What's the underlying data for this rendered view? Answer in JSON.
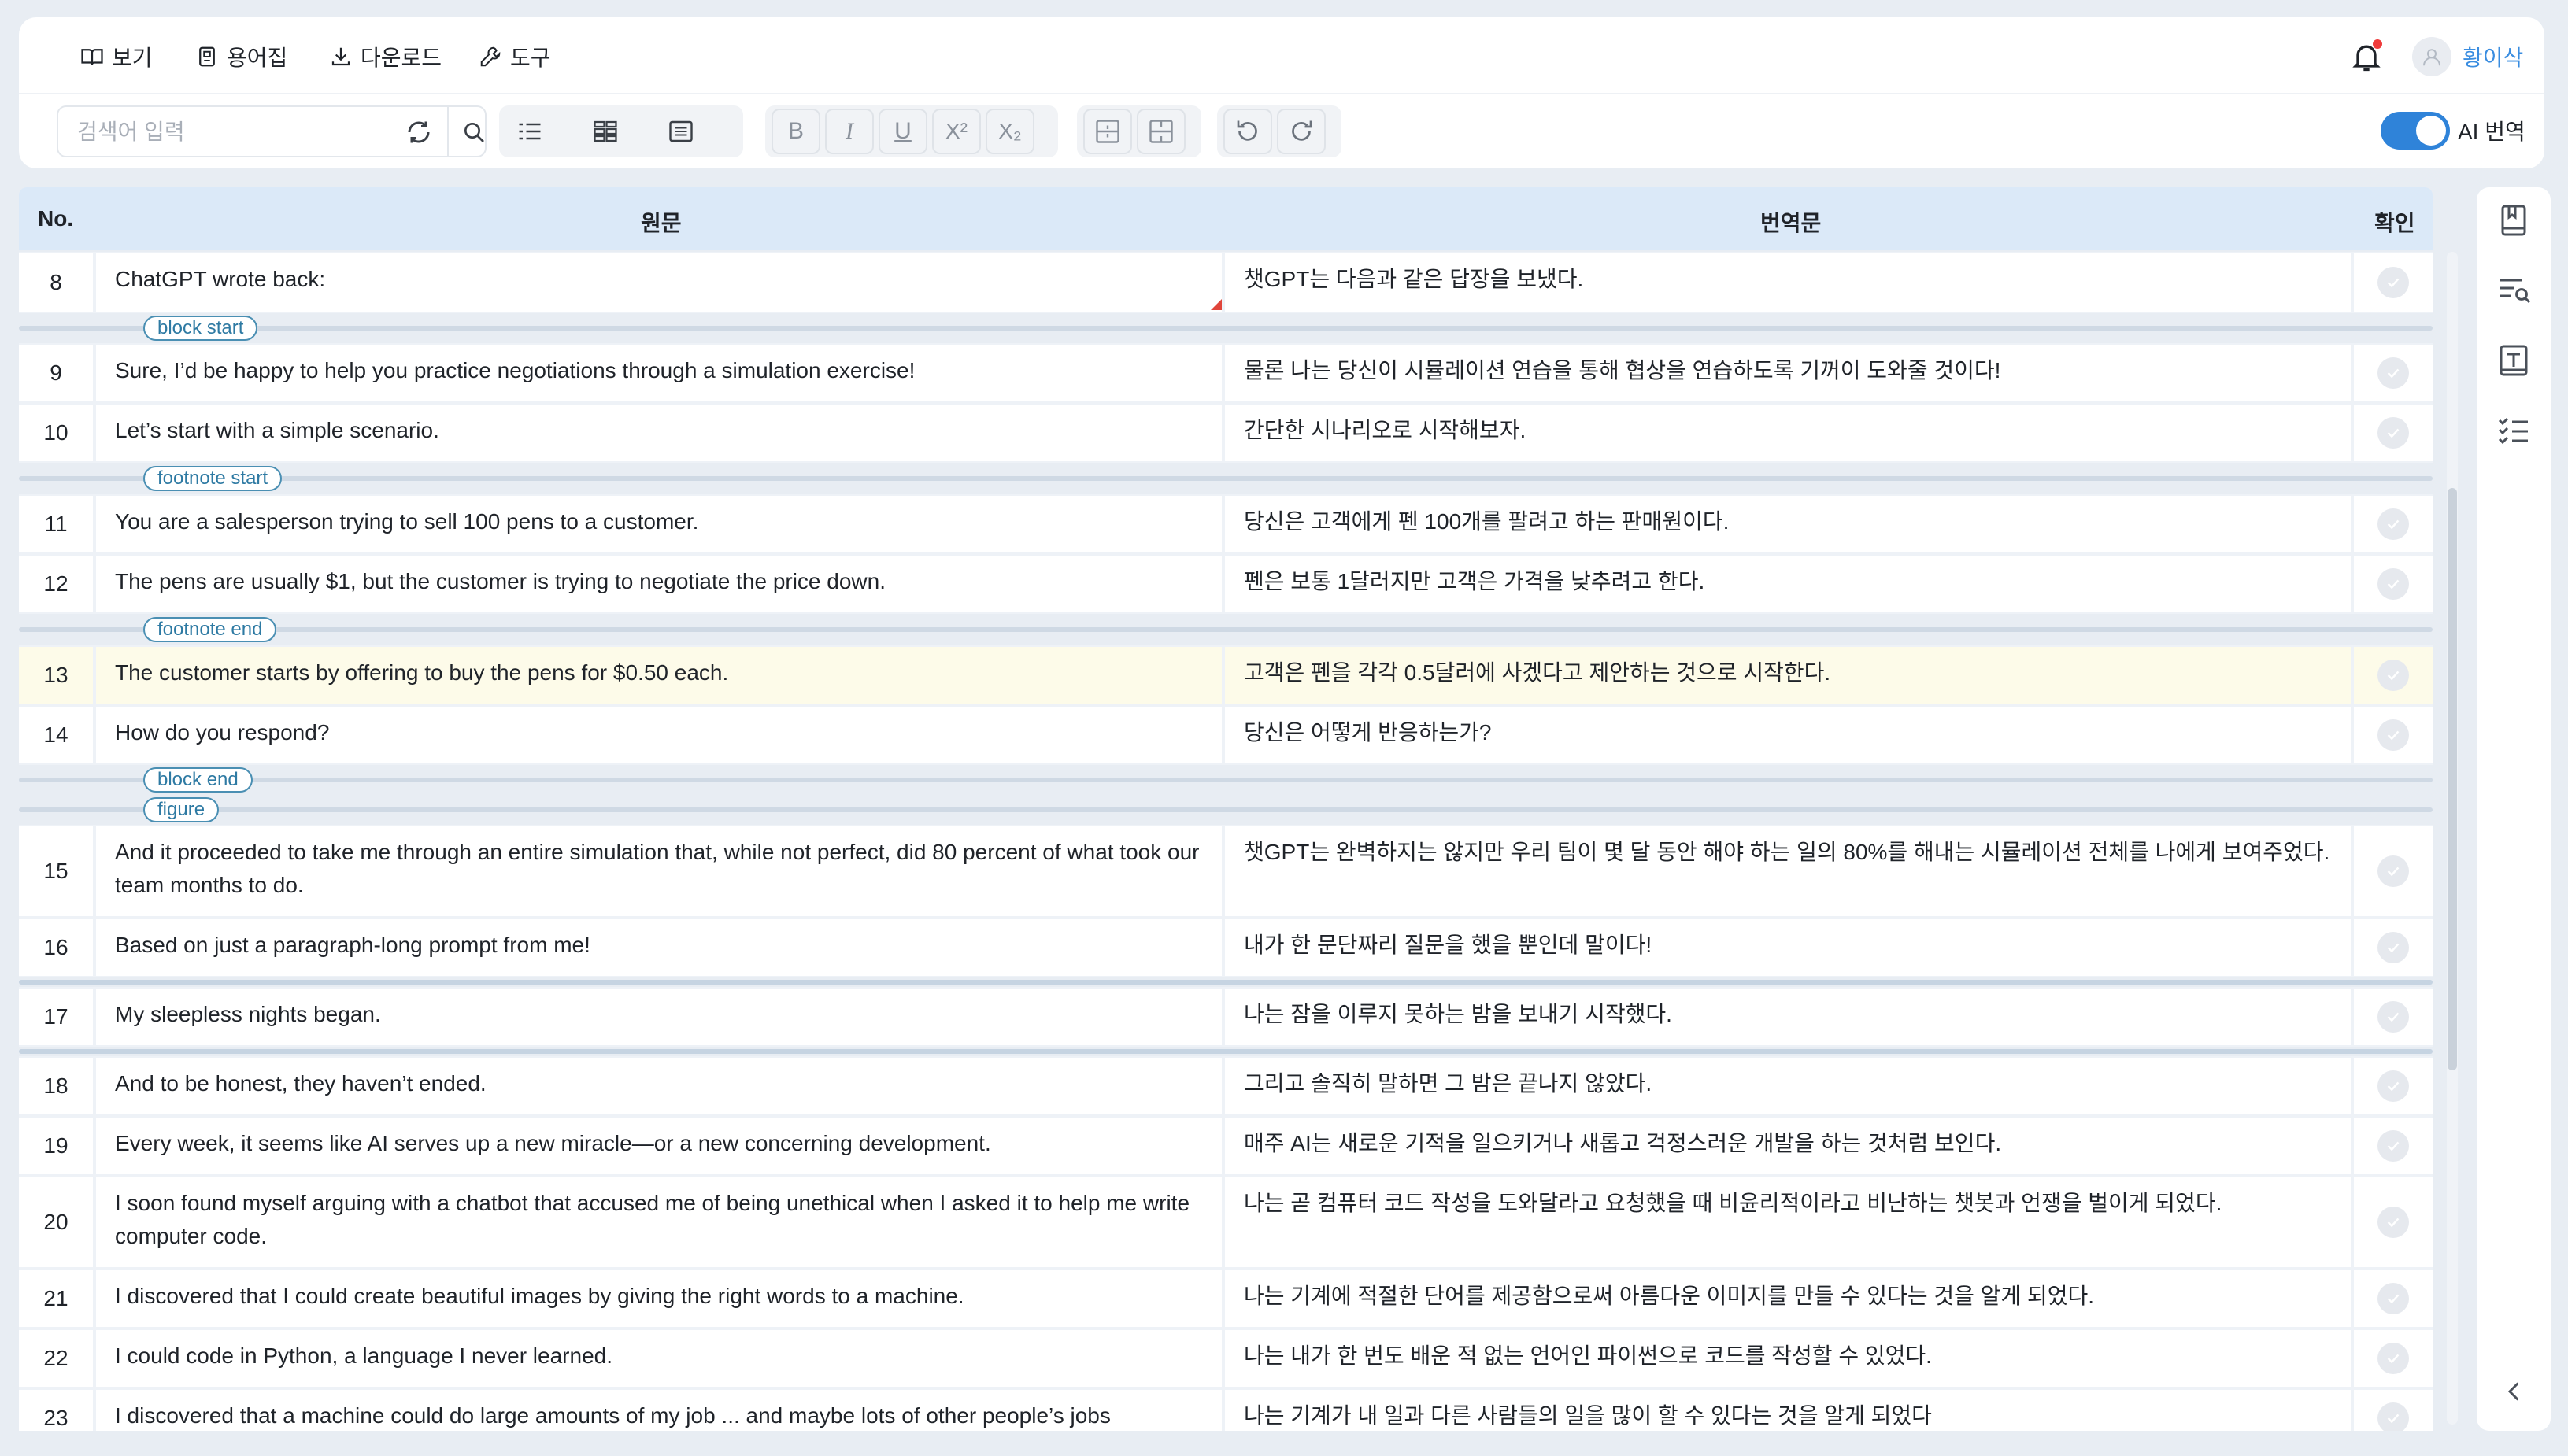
{
  "menu": {
    "view": "보기",
    "glossary": "용어집",
    "download": "다운로드",
    "tools": "도구"
  },
  "user": {
    "name": "황이삭"
  },
  "search": {
    "placeholder": "검색어 입력"
  },
  "format": {
    "bold": "B",
    "italic": "I",
    "underline": "U",
    "superscript": "X²",
    "subscript": "X₂"
  },
  "ai_toggle": {
    "label": "AI 번역",
    "on": true
  },
  "table": {
    "headers": {
      "no": "No.",
      "source": "원문",
      "target": "번역문",
      "confirm": "확인"
    },
    "rows": [
      {
        "no": "8",
        "src": "ChatGPT wrote back:",
        "tgt": "챗GPT는 다음과 같은 답장을 보냈다."
      },
      {
        "no": "9",
        "src": "Sure, I’d be happy to help you practice negotiations through a simulation exercise!",
        "tgt": "물론 나는 당신이 시뮬레이션 연습을 통해 협상을 연습하도록 기꺼이 도와줄 것이다!"
      },
      {
        "no": "10",
        "src": "Let’s start with a simple scenario.",
        "tgt": "간단한 시나리오로 시작해보자."
      },
      {
        "no": "11",
        "src": "You are a salesperson trying to sell 100 pens to a customer.",
        "tgt": "당신은 고객에게 펜 100개를 팔려고 하는 판매원이다."
      },
      {
        "no": "12",
        "src": "The pens are usually $1, but the customer is trying to negotiate the price down.",
        "tgt": "펜은 보통 1달러지만 고객은 가격을 낮추려고 한다."
      },
      {
        "no": "13",
        "src": "The customer starts by offering to buy the pens for $0.50 each.",
        "tgt": "고객은 펜을 각각 0.5달러에 사겠다고 제안하는 것으로 시작한다."
      },
      {
        "no": "14",
        "src": "How do you respond?",
        "tgt": "당신은 어떻게 반응하는가?"
      },
      {
        "no": "15",
        "src": "And it proceeded to take me through an entire simulation that, while not perfect, did 80 percent of what took our team months to do.",
        "tgt": "챗GPT는 완벽하지는 않지만 우리 팀이 몇 달 동안 해야 하는 일의 80%를 해내는 시뮬레이션 전체를 나에게 보여주었다."
      },
      {
        "no": "16",
        "src": "Based on just a paragraph-long prompt from me!",
        "tgt": "내가 한 문단짜리 질문을 했을 뿐인데 말이다!"
      },
      {
        "no": "17",
        "src": "My sleepless nights began.",
        "tgt": "나는 잠을 이루지 못하는 밤을 보내기 시작했다."
      },
      {
        "no": "18",
        "src": "And to be honest, they haven’t ended.",
        "tgt": "그리고 솔직히 말하면 그 밤은 끝나지 않았다."
      },
      {
        "no": "19",
        "src": "Every week, it seems like AI serves up a new miracle—or a new concerning development.",
        "tgt": "매주 AI는 새로운 기적을 일으키거나 새롭고 걱정스러운 개발을 하는 것처럼 보인다."
      },
      {
        "no": "20",
        "src": "I soon found myself arguing with a chatbot that accused me of being unethical when I asked it to help me write computer code.",
        "tgt": "나는 곧 컴퓨터 코드 작성을 도와달라고 요청했을 때 비윤리적이라고 비난하는 챗봇과 언쟁을 벌이게 되었다."
      },
      {
        "no": "21",
        "src": "I discovered that I could create beautiful images by giving the right words to a machine.",
        "tgt": "나는 기계에 적절한 단어를 제공함으로써 아름다운 이미지를 만들 수 있다는 것을 알게 되었다."
      },
      {
        "no": "22",
        "src": "I could code in Python, a language I never learned.",
        "tgt": "나는 내가 한 번도 배운 적 없는 언어인 파이썬으로 코드를 작성할 수 있었다."
      },
      {
        "no": "23",
        "src": "I discovered that a machine could do large amounts of my job ... and maybe lots of other people’s jobs",
        "tgt": "나는 기계가 내 일과 다른 사람들의 일을 많이 할 수 있다는 것을 알게 되었다"
      }
    ],
    "tags": {
      "block_start": "block start",
      "footnote_start": "footnote start",
      "footnote_end": "footnote end",
      "block_end": "block end",
      "figure": "figure"
    }
  },
  "colors": {
    "accent": "#2f83d9",
    "header_bg": "#dbe9f8",
    "highlight_row": "#fdfbe9",
    "tag_border": "#4a8fb3"
  }
}
